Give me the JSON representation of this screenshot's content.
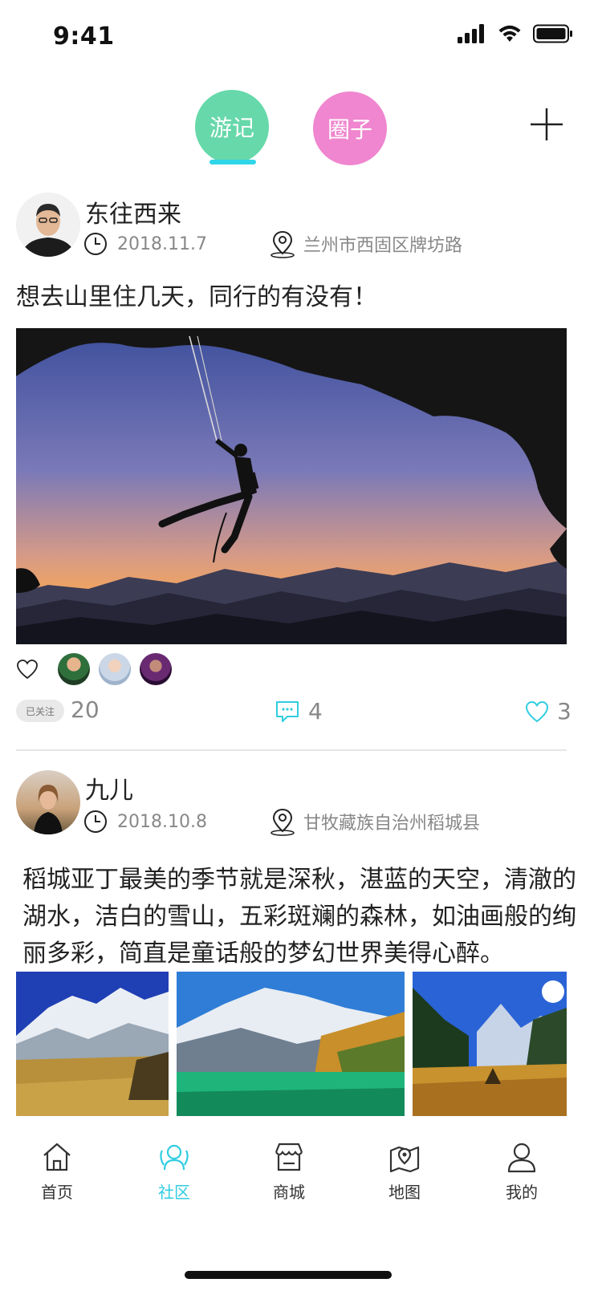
{
  "status_bar": {
    "time": "9:41",
    "icons": [
      "cellular-signal-icon",
      "wifi-icon",
      "battery-icon"
    ]
  },
  "top_tabs": {
    "tabs": [
      {
        "label": "游记",
        "color": "#67d8a9",
        "active": true
      },
      {
        "label": "圈子",
        "color": "#ef86cf",
        "active": false
      }
    ],
    "underline_color": "#30d6e8",
    "add_icon": "plus-icon"
  },
  "posts": [
    {
      "author": "东往西来",
      "date": "2018.11.7",
      "location": "兰州市西固区牌坊路",
      "text": "想去山里住几天，同行的有没有！",
      "image": "rock-climber-sunset-cave-photo",
      "followed_label": "已关注",
      "follow_count": "20",
      "comment_count": "4",
      "like_count": "3"
    },
    {
      "author": "九儿",
      "date": "2018.10.8",
      "location": "甘牧藏族自治州稻城县",
      "text": "稻城亚丁最美的季节就是深秋，湛蓝的天空，清澈的湖水，洁白的雪山，五彩斑斓的森林，如油画般的绚丽多彩，简直是童话般的梦幻世界美得心醉。",
      "images": [
        "snow-mountain-meadow-photo",
        "glacier-lake-forest-photo",
        "valley-sunburst-photo"
      ]
    }
  ],
  "bottom_nav": {
    "items": [
      {
        "label": "首页",
        "icon": "home-icon",
        "active": false
      },
      {
        "label": "社区",
        "icon": "community-icon",
        "active": true
      },
      {
        "label": "商城",
        "icon": "store-icon",
        "active": false
      },
      {
        "label": "地图",
        "icon": "map-icon",
        "active": false
      },
      {
        "label": "我的",
        "icon": "profile-icon",
        "active": false
      }
    ],
    "active_color": "#30cde0"
  }
}
